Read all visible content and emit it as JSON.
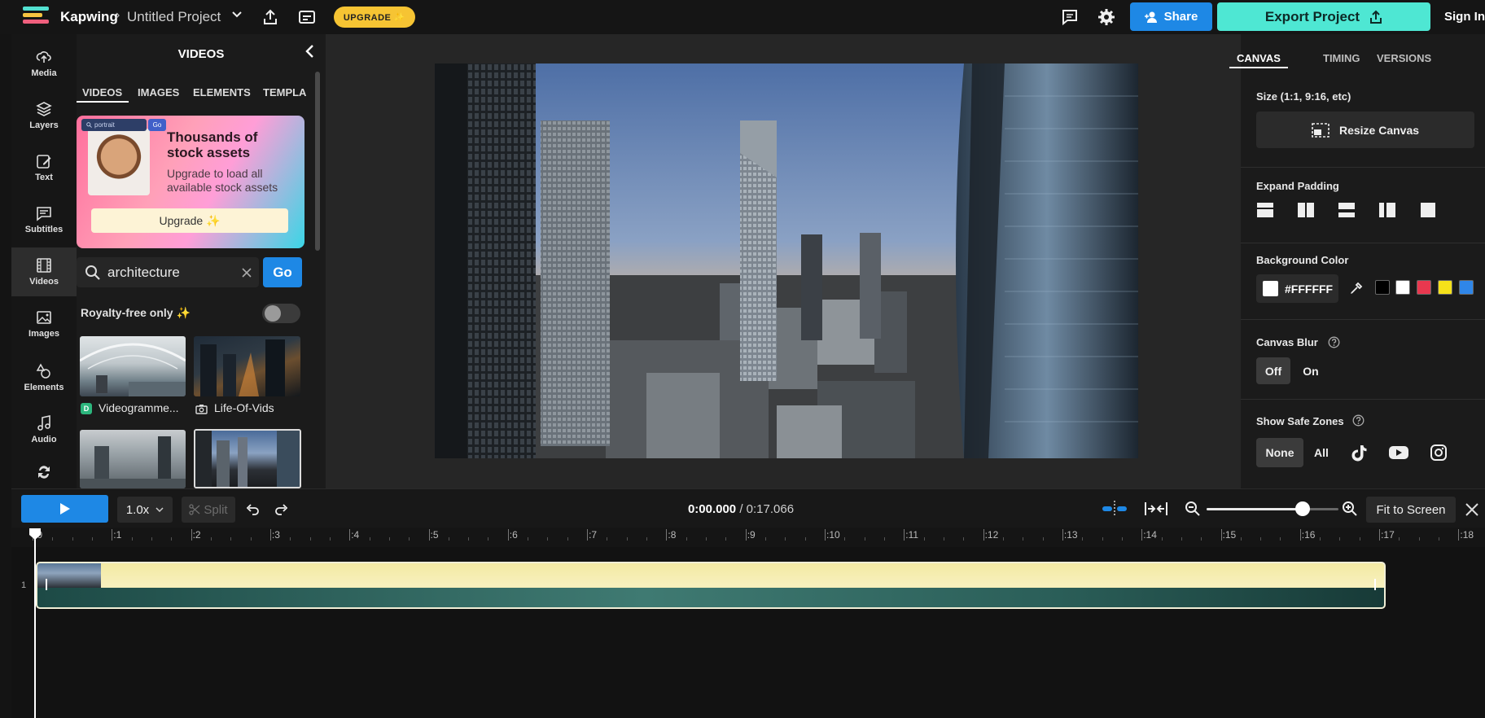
{
  "app": {
    "brand": "Kapwing",
    "separator": "›",
    "project_title": "Untitled Project",
    "upgrade_label": "UPGRADE ✨",
    "share_label": "Share",
    "export_label": "Export Project",
    "signin_label": "Sign In"
  },
  "colors": {
    "accent_blue": "#1e88e5",
    "export_teal": "#4ee7d3",
    "upgrade_yellow": "#f6c433"
  },
  "rail": [
    {
      "label": "Media",
      "icon": "upload-cloud-icon"
    },
    {
      "label": "Layers",
      "icon": "layers-icon"
    },
    {
      "label": "Text",
      "icon": "text-edit-icon"
    },
    {
      "label": "Subtitles",
      "icon": "subtitles-icon"
    },
    {
      "label": "Videos",
      "icon": "film-icon",
      "active": true
    },
    {
      "label": "Images",
      "icon": "image-icon"
    },
    {
      "label": "Elements",
      "icon": "shapes-icon"
    },
    {
      "label": "Audio",
      "icon": "music-note-icon"
    },
    {
      "label": "",
      "icon": "transitions-icon"
    }
  ],
  "panel": {
    "title": "VIDEOS",
    "tabs": [
      "VIDEOS",
      "IMAGES",
      "ELEMENTS",
      "TEMPLA"
    ],
    "promo": {
      "search_text": "portrait",
      "search_go": "Go",
      "headline": "Thousands of stock assets",
      "subtext": "Upgrade to load all available stock assets",
      "button": "Upgrade ✨"
    },
    "search": {
      "value": "architecture",
      "go_label": "Go"
    },
    "royalty_label": "Royalty-free only ✨",
    "royalty_enabled": false,
    "results": [
      {
        "caption": "Videogramme...",
        "source_icon": "D"
      },
      {
        "caption": "Life-Of-Vids",
        "source_icon": "camera-icon"
      }
    ]
  },
  "right_panel": {
    "tabs": [
      "CANVAS",
      "TIMING",
      "VERSIONS"
    ],
    "size_label": "Size (1:1, 9:16, etc)",
    "resize_button": "Resize Canvas",
    "expand_padding_label": "Expand Padding",
    "background_label": "Background Color",
    "background_value": "#FFFFFF",
    "swatches": [
      "#000000",
      "#ffffff",
      "#e8384f",
      "#f5e11a",
      "#2f86e8"
    ],
    "blur_label": "Canvas Blur",
    "blur_off": "Off",
    "blur_on": "On",
    "safe_zones_label": "Show Safe Zones",
    "safe_none": "None",
    "safe_all": "All"
  },
  "timeline": {
    "speed": "1.0x",
    "split_label": "Split",
    "current_time": "0:00.000",
    "time_sep": " / ",
    "total_time": "0:17.066",
    "fit_label": "Fit to Screen",
    "zoom_fraction": 0.73,
    "ruler": [
      ":0",
      ":1",
      ":2",
      ":3",
      ":4",
      ":5",
      ":6",
      ":7",
      ":8",
      ":9",
      ":10",
      ":11",
      ":12",
      ":13",
      ":14",
      ":15",
      ":16",
      ":17",
      ":18"
    ],
    "track_number": "1"
  }
}
